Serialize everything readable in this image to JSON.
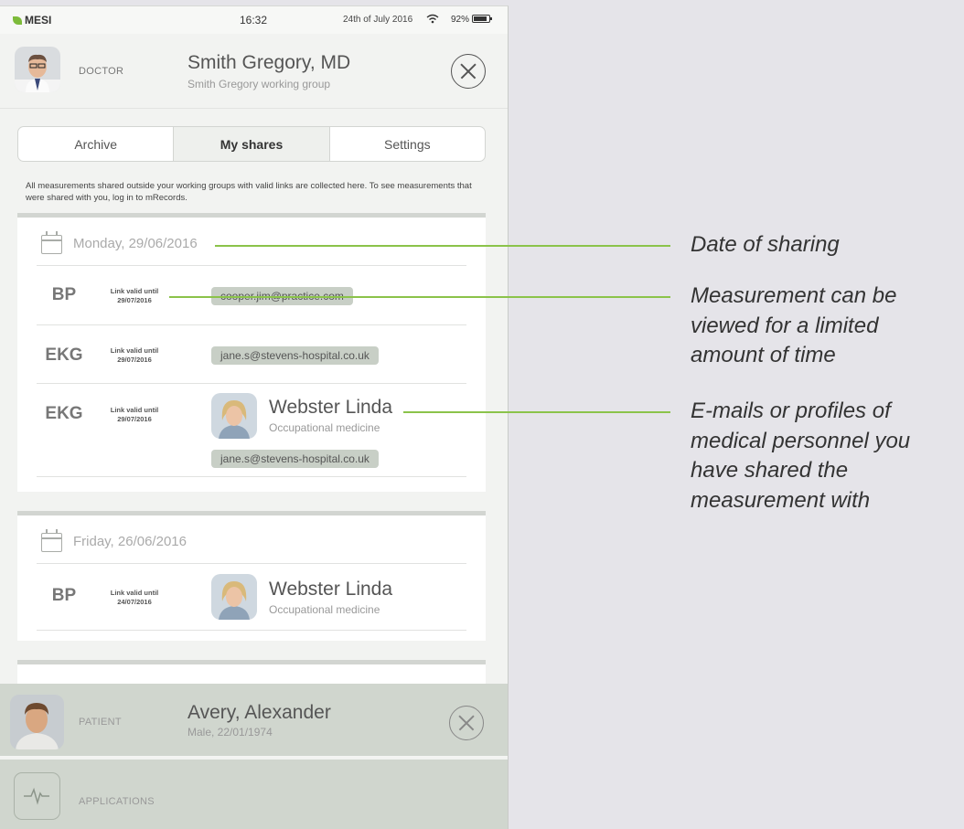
{
  "status": {
    "carrier": "MESI",
    "time": "16:32",
    "date": "24th of July 2016",
    "battery": "92%"
  },
  "doctor": {
    "role": "DOCTOR",
    "name": "Smith Gregory, MD",
    "group": "Smith Gregory working group"
  },
  "tabs": [
    {
      "label": "Archive"
    },
    {
      "label": "My shares"
    },
    {
      "label": "Settings"
    }
  ],
  "info": "All measurements shared outside your working groups with valid links are collected here. To see measurements that were shared with you, log in to mRecords.",
  "shares": [
    {
      "date": "Monday, 29/06/2016",
      "rows": [
        {
          "type": "BP",
          "valid_label": "Link valid until",
          "valid_date": "29/07/2016",
          "email": "cooper.jim@practice.com"
        },
        {
          "type": "EKG",
          "valid_label": "Link valid until",
          "valid_date": "29/07/2016",
          "email": "jane.s@stevens-hospital.co.uk"
        },
        {
          "type": "EKG",
          "valid_label": "Link valid until",
          "valid_date": "29/07/2016",
          "person_name": "Webster Linda",
          "person_dept": "Occupational medicine",
          "email": "jane.s@stevens-hospital.co.uk"
        }
      ]
    },
    {
      "date": "Friday, 26/06/2016",
      "rows": [
        {
          "type": "BP",
          "valid_label": "Link valid until",
          "valid_date": "24/07/2016",
          "person_name": "Webster Linda",
          "person_dept": "Occupational medicine"
        }
      ]
    }
  ],
  "patient": {
    "role": "PATIENT",
    "name": "Avery, Alexander",
    "info": "Male, 22/01/1974"
  },
  "applications": {
    "label": "APPLICATIONS"
  },
  "callouts": [
    {
      "text": "Date of sharing"
    },
    {
      "text": "Measurement can be viewed for a limited amount of time"
    },
    {
      "text": "E-mails or profiles of medical personnel you have shared the measurement with"
    }
  ],
  "colors": {
    "accent": "#8bc34a",
    "brand": "#7dbb3a",
    "patient_bg": "#d0d6ce"
  },
  "icons": [
    "calendar-icon",
    "close-icon",
    "wifi-icon",
    "battery-icon",
    "pulse-icon"
  ]
}
